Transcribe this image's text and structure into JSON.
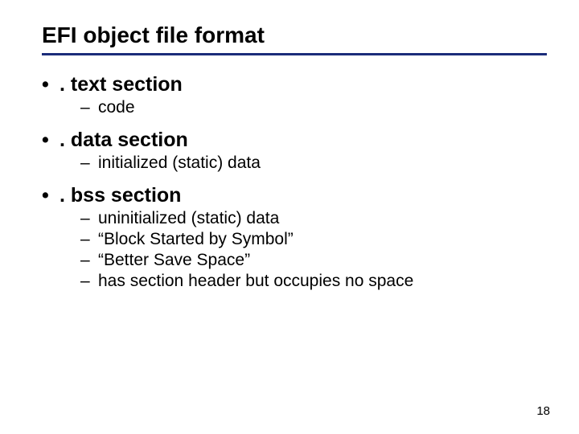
{
  "title": "EFI object file format",
  "page_number": "18",
  "items": [
    {
      "label": ". text section",
      "sub": [
        "code"
      ]
    },
    {
      "label": ". data section",
      "sub": [
        "initialized (static) data"
      ]
    },
    {
      "label": ". bss section",
      "sub": [
        "uninitialized (static) data",
        "“Block Started by Symbol”",
        "“Better Save Space”",
        "has section header but occupies no space"
      ]
    }
  ]
}
